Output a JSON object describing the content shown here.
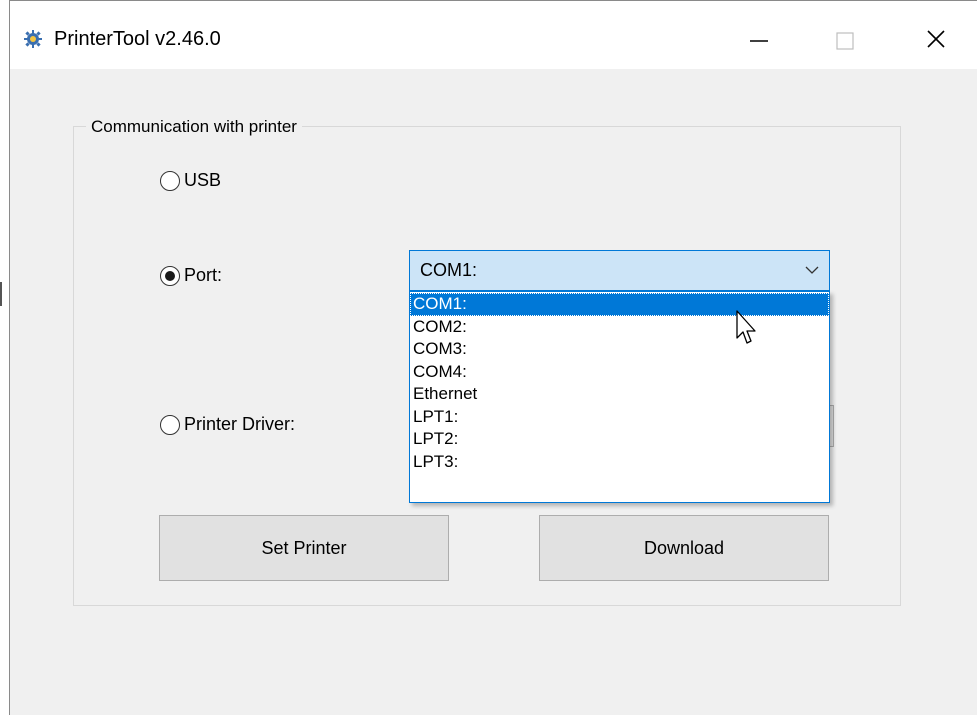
{
  "window": {
    "title": "PrinterTool v2.46.0",
    "icons": {
      "app": "gear-icon",
      "minimize": "minimize-icon",
      "maximize": "maximize-icon",
      "close": "close-icon"
    }
  },
  "group": {
    "title": "Communication with printer"
  },
  "options": {
    "usb_label": "USB",
    "port_label": "Port:",
    "driver_label": "Printer Driver:",
    "selected": "Port:"
  },
  "port_combo": {
    "value": "COM1:",
    "items": [
      "COM1:",
      "COM2:",
      "COM3:",
      "COM4:",
      "Ethernet",
      "LPT1:",
      "LPT2:",
      "LPT3:"
    ],
    "highlighted": "COM1:"
  },
  "buttons": {
    "set_printer": "Set Printer",
    "download": "Download"
  },
  "colors": {
    "accent": "#0078d7",
    "combo_bg": "#cce4f7",
    "window_bg": "#f0f0f0"
  }
}
